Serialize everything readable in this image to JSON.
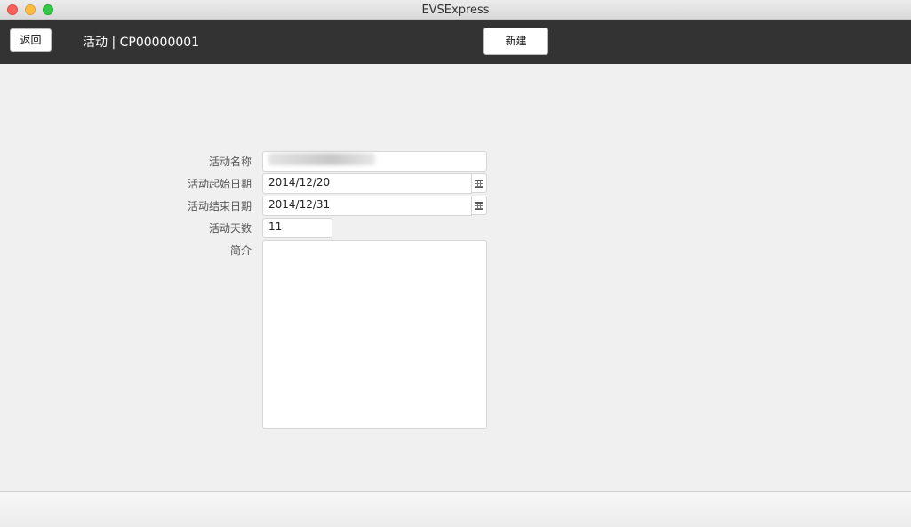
{
  "window": {
    "title": "EVSExpress"
  },
  "toolbar": {
    "back_label": "返回",
    "page_title": "活动 | CP00000001",
    "new_label": "新建"
  },
  "form": {
    "name_label": "活动名称",
    "name_value": "",
    "start_label": "活动起始日期",
    "start_value": "2014/12/20",
    "end_label": "活动结束日期",
    "end_value": "2014/12/31",
    "days_label": "活动天数",
    "days_value": "11",
    "intro_label": "简介",
    "intro_value": ""
  },
  "icons": {
    "calendar": "calendar-icon"
  }
}
